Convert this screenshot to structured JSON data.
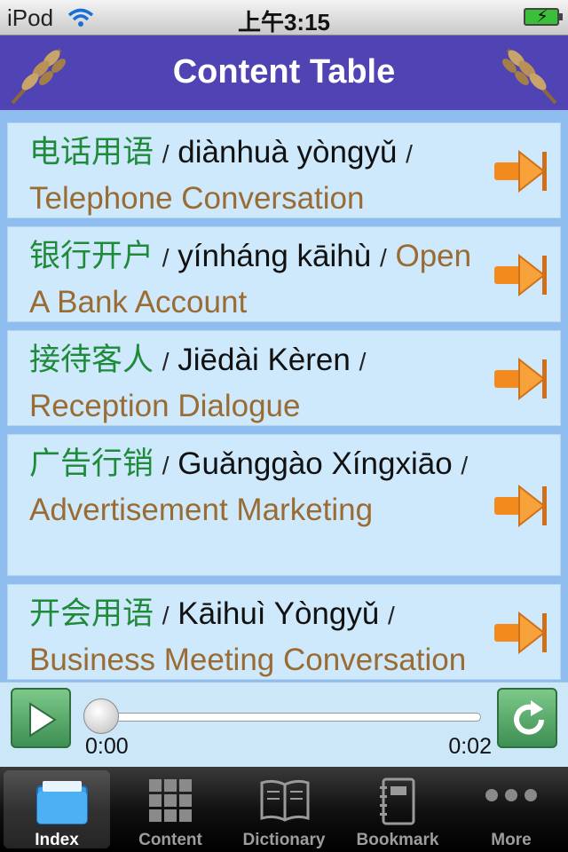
{
  "status_bar": {
    "carrier": "iPod",
    "time": "上午3:15"
  },
  "header": {
    "title": "Content Table"
  },
  "rows": [
    {
      "chinese": "电话用语",
      "separator": "/",
      "pinyin": "diànhuà yòngyǔ",
      "separator2": "/",
      "english": "Telephone Conversation"
    },
    {
      "chinese": "银行开户",
      "separator": "/",
      "pinyin": "yínháng kāihù",
      "separator2": "/",
      "english": "Open A Bank Account"
    },
    {
      "chinese": "接待客人",
      "separator": "/",
      "pinyin": "Jiēdài Kèren",
      "separator2": "/",
      "english": "Reception Dialogue"
    },
    {
      "chinese": "广告行销",
      "separator": "/",
      "pinyin": "Guǎnggào Xíngxiāo",
      "separator2": "/",
      "english": "Advertisement Marketing"
    },
    {
      "chinese": "开会用语",
      "separator": "/",
      "pinyin": "Kāihuì Yòngyǔ",
      "separator2": "/",
      "english": "Business Meeting Conversation"
    }
  ],
  "player": {
    "current_time": "0:00",
    "total_time": "0:02",
    "progress": 0
  },
  "tabbar": {
    "tabs": [
      {
        "label": "Index",
        "icon": "folder-icon",
        "active": true
      },
      {
        "label": "Content",
        "icon": "grid-icon",
        "active": false
      },
      {
        "label": "Dictionary",
        "icon": "book-icon",
        "active": false
      },
      {
        "label": "Bookmark",
        "icon": "notebook-icon",
        "active": false
      },
      {
        "label": "More",
        "icon": "more-icon",
        "active": false
      }
    ]
  },
  "colors": {
    "header_bg": "#5043b4",
    "content_bg": "#8fbdf0",
    "row_bg": "#cde9fb",
    "chinese_text": "#1e8a3a",
    "english_text": "#9a6b32",
    "button_green": "#3e8f53"
  }
}
